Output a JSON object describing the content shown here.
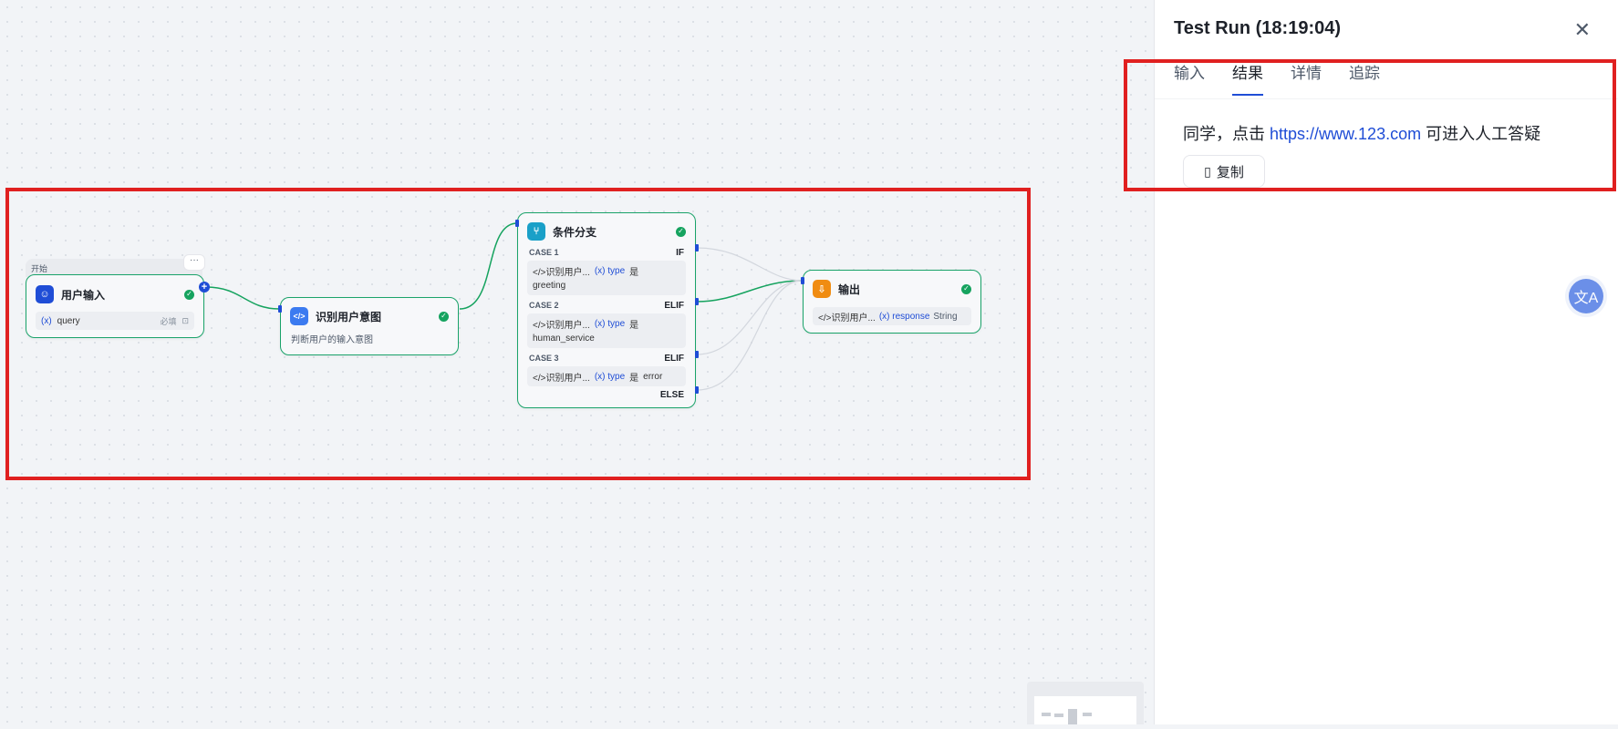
{
  "canvas": {
    "start_node": {
      "tag": "开始",
      "title": "用户输入",
      "param_icon": "(x)",
      "param_name": "query",
      "required_label": "必填"
    },
    "intent_node": {
      "title": "识别用户意图",
      "description": "判断用户的输入意图"
    },
    "branch_node": {
      "title": "条件分支",
      "cases": [
        {
          "label": "CASE 1",
          "keyword": "IF",
          "source": "识别用户...",
          "var": "(x) type",
          "op": "是",
          "value": "greeting"
        },
        {
          "label": "CASE 2",
          "keyword": "ELIF",
          "source": "识别用户...",
          "var": "(x) type",
          "op": "是",
          "value": "human_service"
        },
        {
          "label": "CASE 3",
          "keyword": "ELIF",
          "source": "识别用户...",
          "var": "(x) type",
          "op": "是",
          "value": "error"
        }
      ],
      "else_keyword": "ELSE"
    },
    "output_node": {
      "title": "输出",
      "source": "识别用户...",
      "var": "(x) response",
      "type": "String"
    }
  },
  "panel": {
    "title": "Test Run (18:19:04)",
    "tabs": [
      "输入",
      "结果",
      "详情",
      "追踪"
    ],
    "active_tab": "结果",
    "result_prefix": "同学，点击 ",
    "result_link": "https://www.123.com",
    "result_suffix": " 可进入人工答疑",
    "copy_label": "复制",
    "close_icon": "close-icon"
  },
  "colors": {
    "accent": "#1f4dd6",
    "success": "#16a35f",
    "highlight": "#e02020",
    "branch_icon": "#1aa0c8",
    "output_icon": "#f08c12"
  }
}
